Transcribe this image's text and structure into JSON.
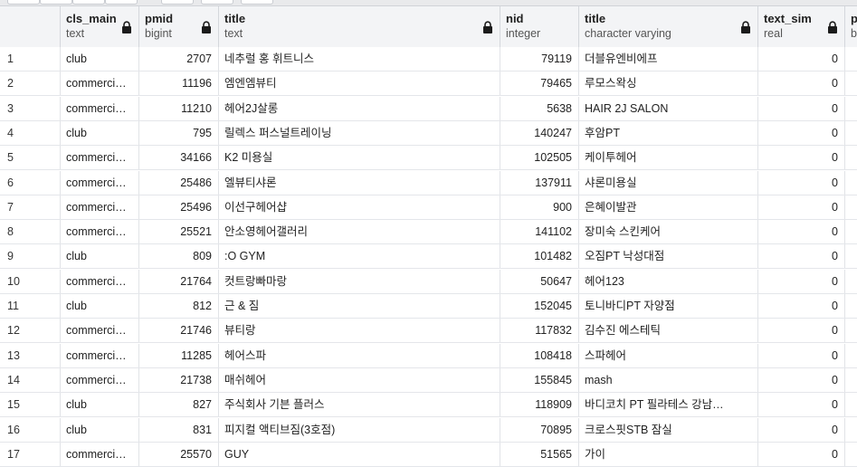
{
  "columns": [
    {
      "name": "",
      "type": ""
    },
    {
      "name": "cls_main",
      "type": "text"
    },
    {
      "name": "pmid",
      "type": "bigint"
    },
    {
      "name": "title",
      "type": "text"
    },
    {
      "name": "nid",
      "type": "integer"
    },
    {
      "name": "title",
      "type": "character varying"
    },
    {
      "name": "text_sim",
      "type": "real"
    },
    {
      "name": "p",
      "type": "b"
    }
  ],
  "rows": [
    [
      "1",
      "club",
      "2707",
      "네추럴 홍 휘트니스",
      "79119",
      "더블유엔비에프",
      "0"
    ],
    [
      "2",
      "commerci…",
      "11196",
      "엠엔엠뷰티",
      "79465",
      "루모스왁싱",
      "0"
    ],
    [
      "3",
      "commerci…",
      "11210",
      "헤어2J살롱",
      "5638",
      "HAIR 2J SALON",
      "0"
    ],
    [
      "4",
      "club",
      "795",
      "릴렉스 퍼스널트레이닝",
      "140247",
      "후암PT",
      "0"
    ],
    [
      "5",
      "commerci…",
      "34166",
      "K2 미용실",
      "102505",
      "케이투헤어",
      "0"
    ],
    [
      "6",
      "commerci…",
      "25486",
      "엘뷰티샤론",
      "137911",
      "샤론미용실",
      "0"
    ],
    [
      "7",
      "commerci…",
      "25496",
      "이선구헤어샵",
      "900",
      "은혜이발관",
      "0"
    ],
    [
      "8",
      "commerci…",
      "25521",
      "안소영헤어갤러리",
      "141102",
      "장미숙 스킨케어",
      "0"
    ],
    [
      "9",
      "club",
      "809",
      ":O GYM",
      "101482",
      "오짐PT 낙성대점",
      "0"
    ],
    [
      "10",
      "commerci…",
      "21764",
      "컷트랑빠마랑",
      "50647",
      "헤어123",
      "0"
    ],
    [
      "11",
      "club",
      "812",
      "근 & 짐",
      "152045",
      "토니바디PT 자양점",
      "0"
    ],
    [
      "12",
      "commerci…",
      "21746",
      "뷰티랑",
      "117832",
      "김수진 에스테틱",
      "0"
    ],
    [
      "13",
      "commerci…",
      "11285",
      "헤어스파",
      "108418",
      "스파헤어",
      "0"
    ],
    [
      "14",
      "commerci…",
      "21738",
      "매쉬헤어",
      "155845",
      "mash",
      "0"
    ],
    [
      "15",
      "club",
      "827",
      "주식회사 기븐 플러스",
      "118909",
      "바디코치 PT 필라테스 강남…",
      "0"
    ],
    [
      "16",
      "club",
      "831",
      "피지컬 액티브짐(3호점)",
      "70895",
      "크로스핏STB 잠실",
      "0"
    ],
    [
      "17",
      "commerci…",
      "25570",
      "GUY",
      "51565",
      "가이",
      "0"
    ]
  ]
}
